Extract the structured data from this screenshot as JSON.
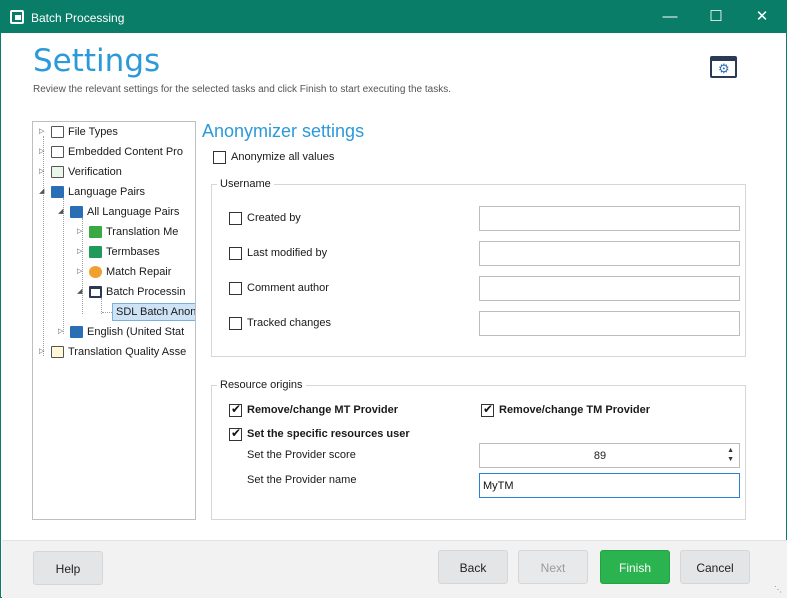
{
  "window": {
    "title": "Batch Processing",
    "minimize": "—",
    "maximize": "☐",
    "close": "✕"
  },
  "header": {
    "title": "Settings",
    "subtitle": "Review the relevant settings for the selected tasks and click Finish to start executing the tasks."
  },
  "tree": {
    "items": [
      {
        "label": "File Types",
        "icon": "file-types-icon"
      },
      {
        "label": "Embedded Content Pro",
        "icon": "embedded-content-icon"
      },
      {
        "label": "Verification",
        "icon": "verification-icon"
      },
      {
        "label": "Language Pairs",
        "icon": "language-pairs-icon"
      },
      {
        "label": "All Language Pairs",
        "icon": "language-pairs-icon"
      },
      {
        "label": "Translation Me",
        "icon": "translation-memory-icon"
      },
      {
        "label": "Termbases",
        "icon": "termbase-icon"
      },
      {
        "label": "Match Repair",
        "icon": "wrench-icon"
      },
      {
        "label": "Batch Processin",
        "icon": "batch-processing-icon"
      },
      {
        "label": "SDL Batch Anon",
        "icon": ""
      },
      {
        "label": "English (United Stat",
        "icon": "language-pairs-icon"
      },
      {
        "label": "Translation Quality Asse",
        "icon": "quality-assessment-icon"
      }
    ]
  },
  "anonymizer": {
    "title": "Anonymizer settings",
    "anonymize_all_label": "Anonymize all values",
    "username_group": "Username",
    "fields": [
      {
        "label": "Created by",
        "value": ""
      },
      {
        "label": "Last modified by",
        "value": ""
      },
      {
        "label": "Comment author",
        "value": ""
      },
      {
        "label": "Tracked changes",
        "value": ""
      }
    ],
    "resource_group": "Resource origins",
    "mt_provider_label": "Remove/change MT Provider",
    "tm_provider_label": "Remove/change TM Provider",
    "specific_user_label": "Set the specific resources user",
    "provider_score_label": "Set the Provider score",
    "provider_score_value": "89",
    "provider_name_label": "Set the Provider name",
    "provider_name_value": "MyTM"
  },
  "footer": {
    "help": "Help",
    "back": "Back",
    "next": "Next",
    "finish": "Finish",
    "cancel": "Cancel"
  },
  "colors": {
    "accent": "#0a7d68",
    "heading": "#2c9ad8",
    "finish": "#2bb34f"
  }
}
